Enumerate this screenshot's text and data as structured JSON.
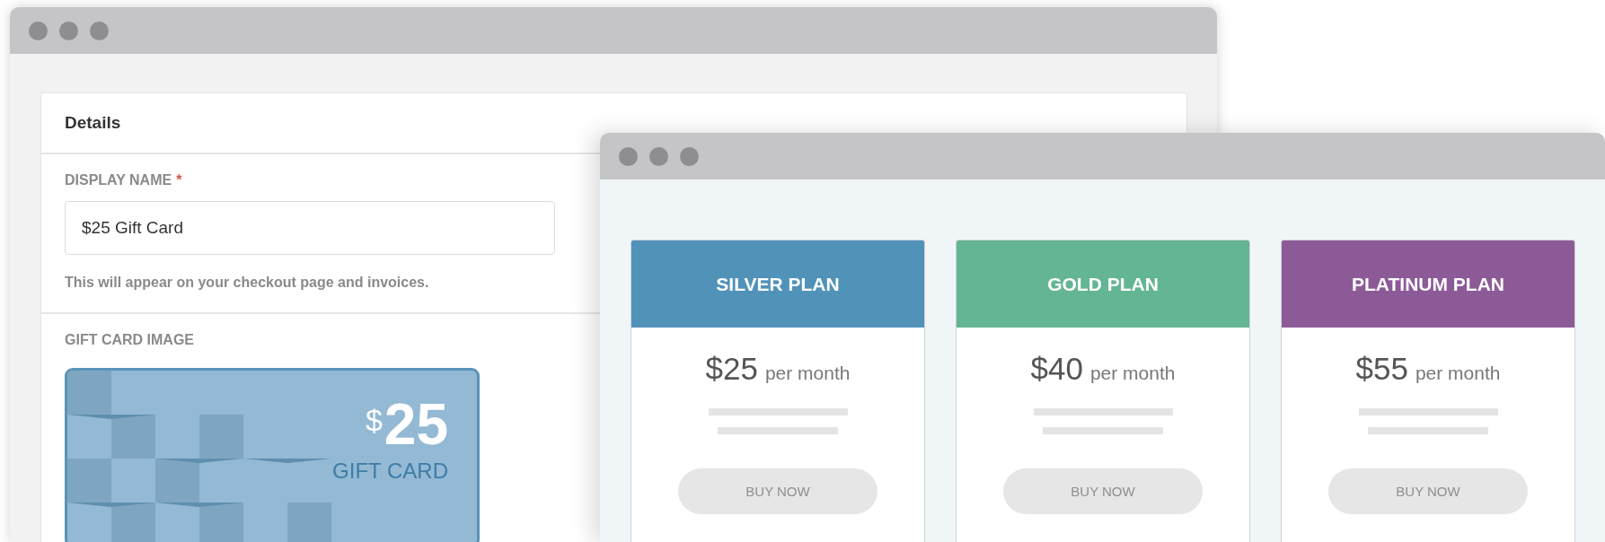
{
  "back_window": {
    "section_title": "Details",
    "display_name": {
      "label": "DISPLAY NAME",
      "required_mark": "*",
      "value": "$25 Gift Card",
      "hint": "This will appear on your checkout page and invoices."
    },
    "gift_card_image": {
      "label": "GIFT CARD IMAGE",
      "currency": "$",
      "amount": "25",
      "caption": "GIFT CARD"
    }
  },
  "front_window": {
    "plans": [
      {
        "title": "SILVER PLAN",
        "color": "#5092b8",
        "price": "$25",
        "period": "per month",
        "button": "BUY NOW"
      },
      {
        "title": "GOLD PLAN",
        "color": "#63b593",
        "price": "$40",
        "period": "per month",
        "button": "BUY NOW"
      },
      {
        "title": "PLATINUM PLAN",
        "color": "#8d5a98",
        "price": "$55",
        "period": "per month",
        "button": "BUY NOW"
      }
    ]
  }
}
